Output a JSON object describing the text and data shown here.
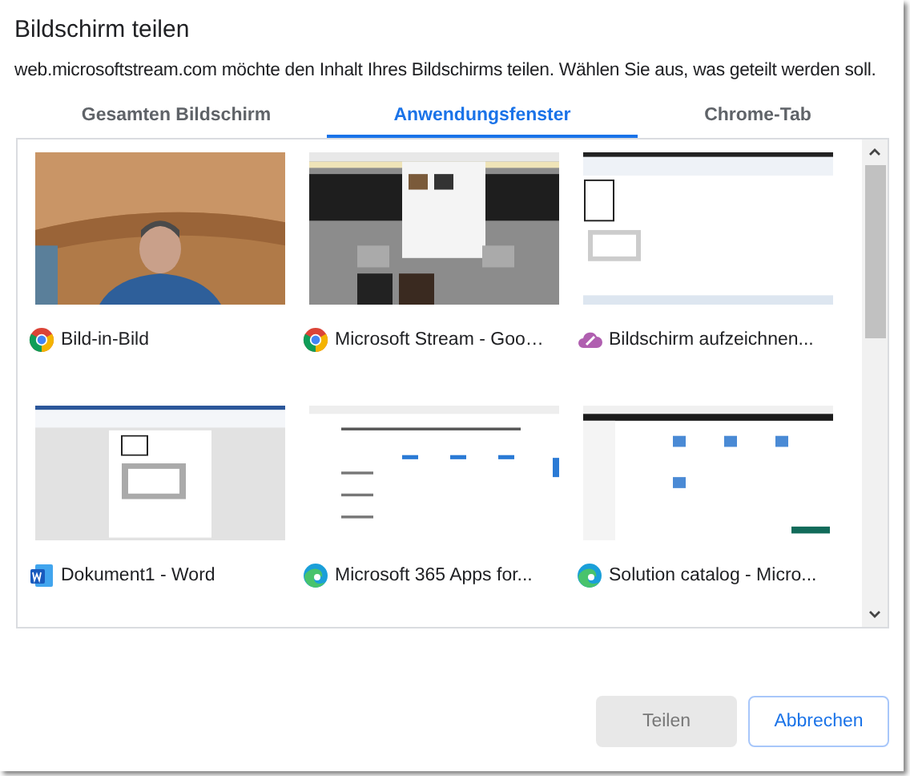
{
  "dialog": {
    "title": "Bildschirm teilen",
    "message": "web.microsoftstream.com möchte den Inhalt Ihres Bildschirms teilen. Wählen Sie aus, was geteilt werden soll."
  },
  "tabs": [
    {
      "label": "Gesamten Bildschirm",
      "selected": false
    },
    {
      "label": "Anwendungsfenster",
      "selected": true
    },
    {
      "label": "Chrome-Tab",
      "selected": false
    }
  ],
  "windows": [
    {
      "title": "Bild-in-Bild",
      "selected": false
    },
    {
      "title": "Microsoft Stream - Goo…",
      "selected": false
    },
    {
      "title": "Bildschirm aufzeichnen...",
      "selected": false
    },
    {
      "title": "Dokument1 - Word",
      "selected": false
    },
    {
      "title": "Microsoft 365 Apps for...",
      "selected": false
    },
    {
      "title": "Solution catalog - Micro...",
      "selected": false
    }
  ],
  "buttons": [
    {
      "label": "Teilen",
      "kind": "primary",
      "disabled": true
    },
    {
      "label": "Abbrechen",
      "kind": "secondary",
      "disabled": false
    }
  ]
}
